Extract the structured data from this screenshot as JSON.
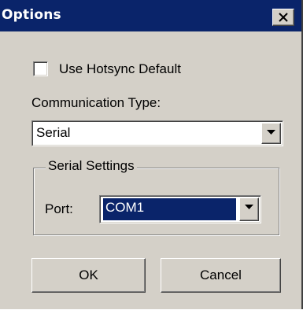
{
  "window": {
    "title": "Options",
    "close_icon": "close-icon"
  },
  "options": {
    "use_hotsync_default_label": "Use Hotsync Default",
    "use_hotsync_default_checked": false,
    "communication_type_label": "Communication Type:",
    "communication_type_value": "Serial"
  },
  "serial_settings": {
    "group_label": "Serial Settings",
    "port_label": "Port:",
    "port_value": "COM1"
  },
  "buttons": {
    "ok_label": "OK",
    "cancel_label": "Cancel"
  },
  "colors": {
    "titlebar": "#0a246a",
    "window_face": "#d4d0c8",
    "selection": "#0a246a"
  }
}
